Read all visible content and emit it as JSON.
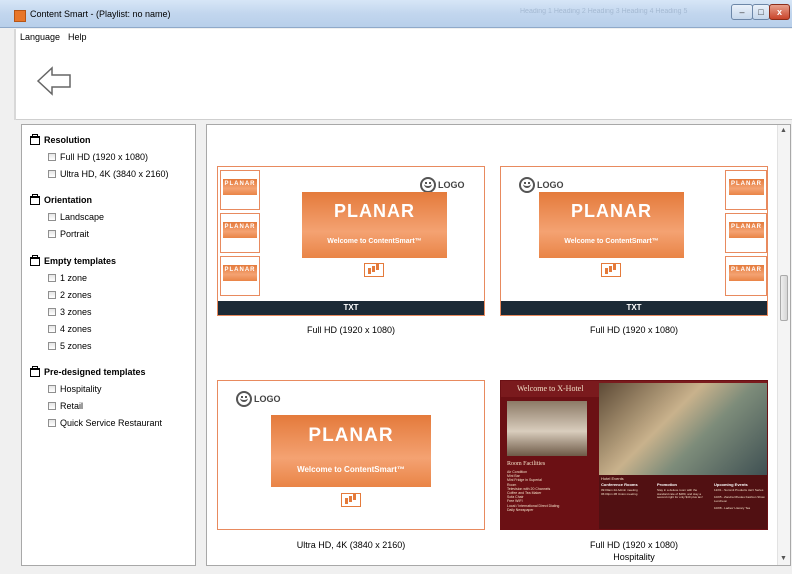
{
  "window": {
    "title": "Content Smart - (Playlist: no name)",
    "faded_background_text": "Heading 1  Heading 2  Heading 3  Heading 4  Heading 5",
    "controls": {
      "minimize": "–",
      "maximize": "□",
      "close": "x"
    }
  },
  "menu": {
    "language": "Language",
    "help": "Help"
  },
  "filters": {
    "groups": [
      {
        "title": "Resolution",
        "options": [
          "Full HD (1920 x 1080)",
          "Ultra HD, 4K (3840 x 2160)"
        ]
      },
      {
        "title": "Orientation",
        "options": [
          "Landscape",
          "Portrait"
        ]
      },
      {
        "title": "Empty templates",
        "options": [
          "1 zone",
          "2 zones",
          "3 zones",
          "4 zones",
          "5 zones"
        ]
      },
      {
        "title": "Pre-designed templates",
        "options": [
          "Hospitality",
          "Retail",
          "Quick Service Restaurant"
        ]
      }
    ]
  },
  "templates": [
    {
      "caption": "Full HD (1920 x 1080)",
      "brand": "PLANAR",
      "welcome": "Welcome to ContentSmart™",
      "logo": "LOGO",
      "mini_brand": "PLANAR",
      "bottom_bar": "TXT"
    },
    {
      "caption": "Full HD (1920 x 1080)",
      "brand": "PLANAR",
      "welcome": "Welcome to ContentSmart™",
      "logo": "LOGO",
      "mini_brand": "PLANAR",
      "bottom_bar": "TXT"
    },
    {
      "caption": "Ultra HD, 4K (3840 x 2160)",
      "brand": "PLANAR",
      "welcome": "Welcome to ContentSmart™",
      "logo": "LOGO"
    },
    {
      "caption": "Full HD (1920 x 1080)",
      "caption2": "Hospitality",
      "hotel_title": "Welcome to X-Hotel",
      "facilities_title": "Room Facilities",
      "facilities": "Air Condition\nMini Bar\nMini Fridge in Superial\nRoom\nTelevision with 20 Channels\nCoffee and Tea Maker\nSofa Chair\nFree WIFI\nLocal / International Direct Dialing\nDaily Newspaper",
      "hotel_events": "Hotel Events",
      "columns": [
        "Conference Rooms",
        "Promotion",
        "Upcoming Events"
      ],
      "col_text": [
        "09:00am  2A  Admin meeting\n06:00pm  2B  Union meeting",
        "Stay in a deluxe room with the standard rate of $280, and stay a second night for only $40 plus tax!",
        "12/01 - Summit Products Jazz Series\n\n10/05 - Zandra Rhodes Fashion Show Luncheon\n\n10/08 - Ladies' Literary Tea"
      ]
    }
  ]
}
